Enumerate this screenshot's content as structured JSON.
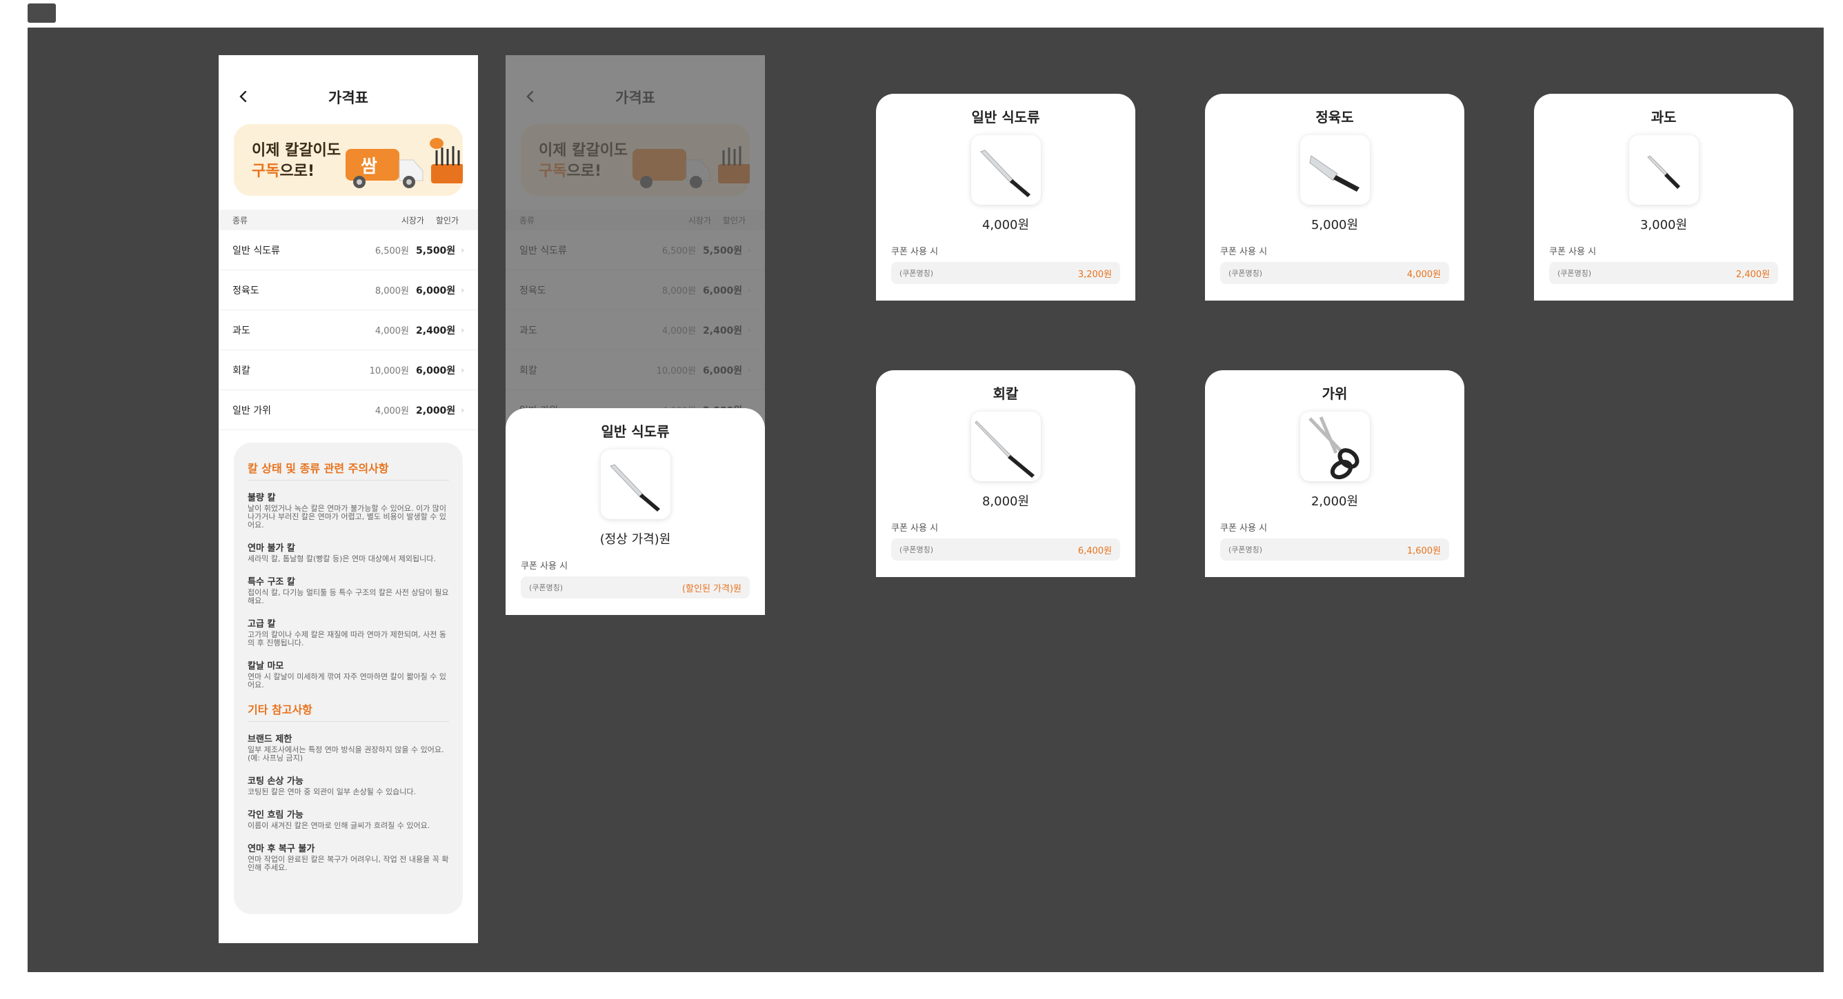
{
  "price_page": {
    "title": "가격표",
    "banner": {
      "line1": "이제 칼갈이도",
      "line2_highlight": "구독",
      "line2_rest": "으로!",
      "badge": "쌈"
    },
    "table_headers": {
      "type": "종류",
      "market": "시장가",
      "discount": "할인가"
    },
    "rows": [
      {
        "name": "일반 식도류",
        "market": "6,500원",
        "discount": "5,500원"
      },
      {
        "name": "정육도",
        "market": "8,000원",
        "discount": "6,000원"
      },
      {
        "name": "과도",
        "market": "4,000원",
        "discount": "2,400원"
      },
      {
        "name": "회칼",
        "market": "10,000원",
        "discount": "6,000원"
      },
      {
        "name": "일반 가위",
        "market": "4,000원",
        "discount": "2,000원"
      }
    ],
    "notes_section1_title": "칼 상태 및 종류 관련 주의사항",
    "notes1": [
      {
        "title": "불량 칼",
        "body": "날이 휘었거나 녹슨 칼은 연마가 불가능할 수 있어요. 이가 많이 나가거나 부러진 칼은 연마가 어렵고, 별도 비용이 발생할 수 있어요."
      },
      {
        "title": "연마 불가 칼",
        "body": "세라믹 칼, 톱날형 칼(빵칼 등)은 연마 대상에서 제외됩니다."
      },
      {
        "title": "특수 구조 칼",
        "body": "접이식 칼, 다기능 멀티툴 등 특수 구조의 칼은 사전 상담이 필요해요."
      },
      {
        "title": "고급 칼",
        "body": "고가의 칼이나 수제 칼은 재질에 따라 연마가 제한되며, 사전 동의 후 진행됩니다."
      },
      {
        "title": "칼날 마모",
        "body": "연마 시 칼날이 미세하게 깎여 자주 연마하면 칼이 짧아질 수 있어요."
      }
    ],
    "notes_section2_title": "기타 참고사항",
    "notes2": [
      {
        "title": "브랜드 제한",
        "body": "일부 제조사에서는 특정 연마 방식을 권장하지 않을 수 있어요. (예: 사프닝 금지)"
      },
      {
        "title": "코팅 손상 가능",
        "body": "코팅된 칼은 연마 중 외관이 일부 손상될 수 있습니다."
      },
      {
        "title": "각인 흐림 가능",
        "body": "이름이 새겨진 칼은 연마로 인해 글씨가 흐려질 수 있어요."
      },
      {
        "title": "연마 후 복구 불가",
        "body": "연마 작업이 완료된 칼은 복구가 어려우니, 작업 전 내용을 꼭 확인해 주세요."
      }
    ]
  },
  "sheet_template": {
    "title": "일반 식도류",
    "price": "(정상 가격)원",
    "coupon_label": "쿠폰 사용 시",
    "coupon_name": "(쿠폰명칭)",
    "coupon_price": "(할인된 가격)원"
  },
  "cards": [
    {
      "title": "일반 식도류",
      "price": "4,000원",
      "coupon_label": "쿠폰 사용 시",
      "coupon_name": "(쿠폰명칭)",
      "coupon_price": "3,200원",
      "icon": "chef-knife-icon"
    },
    {
      "title": "정육도",
      "price": "5,000원",
      "coupon_label": "쿠폰 사용 시",
      "coupon_name": "(쿠폰명칭)",
      "coupon_price": "4,000원",
      "icon": "butcher-knife-icon"
    },
    {
      "title": "과도",
      "price": "3,000원",
      "coupon_label": "쿠폰 사용 시",
      "coupon_name": "(쿠폰명칭)",
      "coupon_price": "2,400원",
      "icon": "paring-knife-icon"
    },
    {
      "title": "회칼",
      "price": "8,000원",
      "coupon_label": "쿠폰 사용 시",
      "coupon_name": "(쿠폰명칭)",
      "coupon_price": "6,400원",
      "icon": "sashimi-knife-icon"
    },
    {
      "title": "가위",
      "price": "2,000원",
      "coupon_label": "쿠폰 사용 시",
      "coupon_name": "(쿠폰명칭)",
      "coupon_price": "1,600원",
      "icon": "scissors-icon"
    }
  ],
  "colors": {
    "accent": "#e8731e",
    "canvas": "#444444",
    "banner_bg": "#fdf0d8"
  }
}
